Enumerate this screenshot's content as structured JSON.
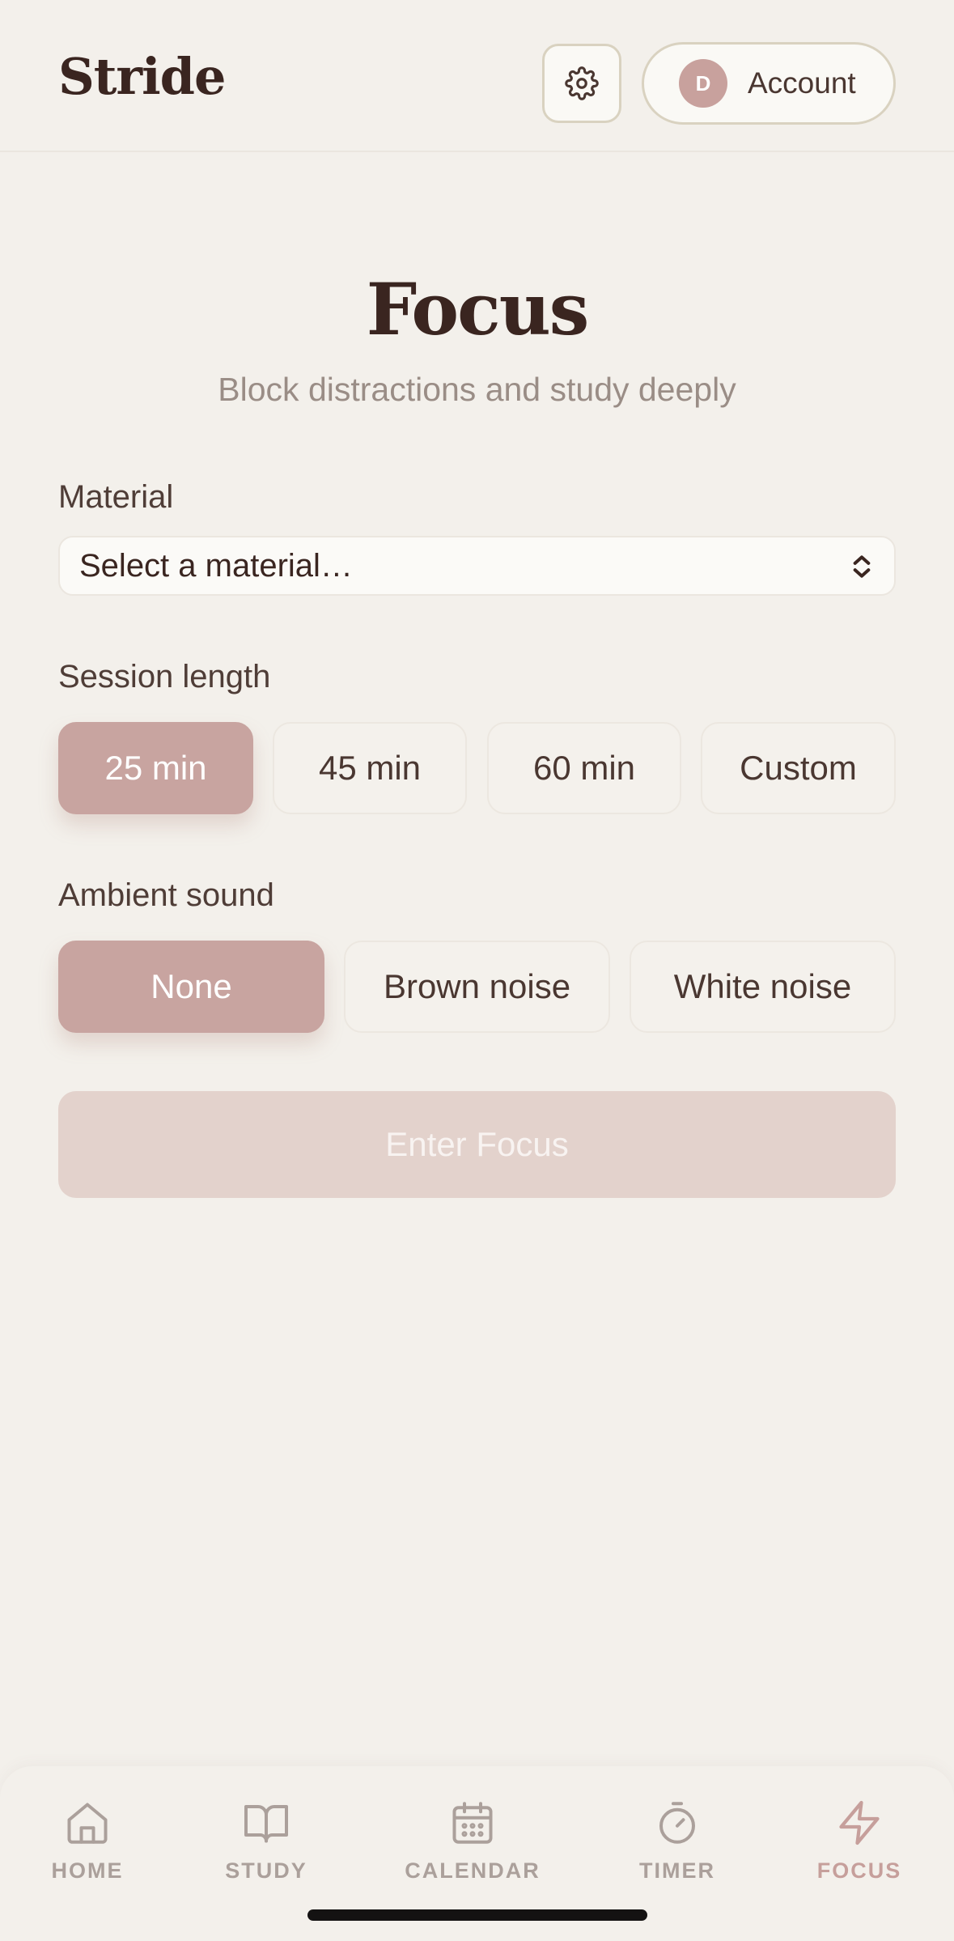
{
  "header": {
    "brand": "Stride",
    "settings_icon": "gear-icon",
    "account": {
      "avatar_initial": "D",
      "label": "Account"
    }
  },
  "main": {
    "title": "Focus",
    "subtitle": "Block distractions and study deeply",
    "material": {
      "label": "Material",
      "selected_value": "Select a material…"
    },
    "session_length": {
      "label": "Session length",
      "options": [
        "25 min",
        "45 min",
        "60 min",
        "Custom"
      ],
      "selected": "25 min"
    },
    "ambient_sound": {
      "label": "Ambient sound",
      "options": [
        "None",
        "Brown noise",
        "White noise"
      ],
      "selected": "None"
    },
    "cta_label": "Enter Focus"
  },
  "bottom_nav": {
    "items": [
      {
        "label": "HOME",
        "icon": "home-icon"
      },
      {
        "label": "STUDY",
        "icon": "book-icon"
      },
      {
        "label": "CALENDAR",
        "icon": "calendar-icon"
      },
      {
        "label": "TIMER",
        "icon": "timer-icon"
      },
      {
        "label": "FOCUS",
        "icon": "lightning-icon"
      }
    ],
    "active": "FOCUS"
  },
  "colors": {
    "background": "#f3f0eb",
    "accent": "#c8a4a0",
    "cta_disabled": "#e3d2cc",
    "text_dark": "#3a2520"
  }
}
